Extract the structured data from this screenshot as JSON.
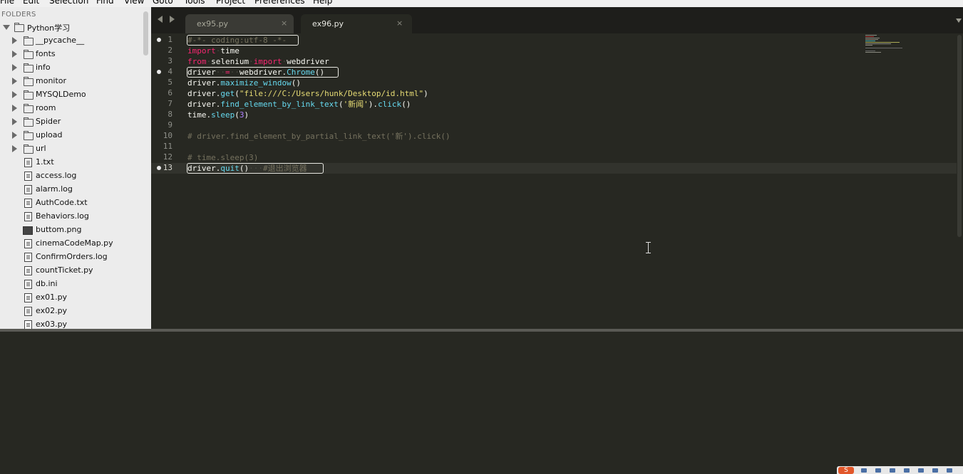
{
  "menu": [
    "File",
    "Edit",
    "Selection",
    "Find",
    "View",
    "Goto",
    "Tools",
    "Project",
    "Preferences",
    "Help"
  ],
  "sidebar": {
    "header": "FOLDERS",
    "root": "Python学习",
    "folders": [
      "__pycache__",
      "fonts",
      "info",
      "monitor",
      "MYSQLDemo",
      "room",
      "Spider",
      "upload",
      "url"
    ],
    "files": [
      {
        "name": "1.txt",
        "icon": "file-icon"
      },
      {
        "name": "access.log",
        "icon": "file-icon"
      },
      {
        "name": "alarm.log",
        "icon": "file-icon"
      },
      {
        "name": "AuthCode.txt",
        "icon": "file-icon"
      },
      {
        "name": "Behaviors.log",
        "icon": "file-icon"
      },
      {
        "name": "buttom.png",
        "icon": "image-icon"
      },
      {
        "name": "cinemaCodeMap.py",
        "icon": "file-icon"
      },
      {
        "name": "ConfirmOrders.log",
        "icon": "file-icon"
      },
      {
        "name": "countTicket.py",
        "icon": "file-icon"
      },
      {
        "name": "db.ini",
        "icon": "file-icon"
      },
      {
        "name": "ex01.py",
        "icon": "file-icon"
      },
      {
        "name": "ex02.py",
        "icon": "file-icon"
      },
      {
        "name": "ex03.py",
        "icon": "file-icon"
      }
    ]
  },
  "tabs": [
    {
      "label": "ex95.py",
      "active": false,
      "close": "×"
    },
    {
      "label": "ex96.py",
      "active": true,
      "close": "×"
    }
  ],
  "editor": {
    "current_line": 13,
    "modified_lines": [
      1,
      4,
      13
    ],
    "lines": [
      {
        "n": "1",
        "tokens": [
          [
            "cmt",
            "#-*- coding:utf-8 -*-"
          ]
        ]
      },
      {
        "n": "2",
        "tokens": [
          [
            "kw",
            "import"
          ],
          [
            "ws",
            "·"
          ],
          [
            "plain",
            "time"
          ]
        ]
      },
      {
        "n": "3",
        "tokens": [
          [
            "kw",
            "from"
          ],
          [
            "ws",
            "·"
          ],
          [
            "plain",
            "selenium"
          ],
          [
            "ws",
            "·"
          ],
          [
            "kw",
            "import"
          ],
          [
            "ws",
            "·"
          ],
          [
            "plain",
            "webdriver"
          ]
        ]
      },
      {
        "n": "4",
        "tokens": [
          [
            "plain",
            "driver"
          ],
          [
            "ws",
            "··"
          ],
          [
            "kw",
            "="
          ],
          [
            "ws",
            "··"
          ],
          [
            "plain",
            "webdriver."
          ],
          [
            "fn",
            "Chrome"
          ],
          [
            "plain",
            "()"
          ]
        ]
      },
      {
        "n": "5",
        "tokens": [
          [
            "plain",
            "driver."
          ],
          [
            "fn",
            "maximize_window"
          ],
          [
            "plain",
            "()"
          ]
        ]
      },
      {
        "n": "6",
        "tokens": [
          [
            "plain",
            "driver."
          ],
          [
            "fn",
            "get"
          ],
          [
            "plain",
            "("
          ],
          [
            "str",
            "\"file:///C:/Users/hunk/Desktop/id.html\""
          ],
          [
            "plain",
            ")"
          ]
        ]
      },
      {
        "n": "7",
        "tokens": [
          [
            "plain",
            "driver."
          ],
          [
            "fn",
            "find_element_by_link_text"
          ],
          [
            "plain",
            "("
          ],
          [
            "str",
            "'新闻'"
          ],
          [
            "plain",
            ")."
          ],
          [
            "fn",
            "click"
          ],
          [
            "plain",
            "()"
          ]
        ]
      },
      {
        "n": "8",
        "tokens": [
          [
            "plain",
            "time."
          ],
          [
            "fn",
            "sleep"
          ],
          [
            "plain",
            "("
          ],
          [
            "num",
            "3"
          ],
          [
            "plain",
            ")"
          ]
        ]
      },
      {
        "n": "9",
        "tokens": []
      },
      {
        "n": "10",
        "tokens": [
          [
            "cmt",
            "# driver.find_element_by_partial_link_text('新').click()"
          ]
        ]
      },
      {
        "n": "11",
        "tokens": []
      },
      {
        "n": "12",
        "tokens": [
          [
            "cmt",
            "# time.sleep(3)"
          ]
        ]
      },
      {
        "n": "13",
        "tokens": [
          [
            "plain",
            "driver."
          ],
          [
            "fn",
            "quit"
          ],
          [
            "plain",
            "()"
          ],
          [
            "ws",
            "···"
          ],
          [
            "cmt",
            "#退出浏览器"
          ]
        ]
      }
    ]
  },
  "tray": {
    "logo": "S"
  },
  "colors": {
    "editor_bg": "#272822",
    "keyword": "#f92672",
    "function": "#66d9ef",
    "string": "#e6db74",
    "number": "#ae81ff",
    "comment": "#75715e"
  }
}
